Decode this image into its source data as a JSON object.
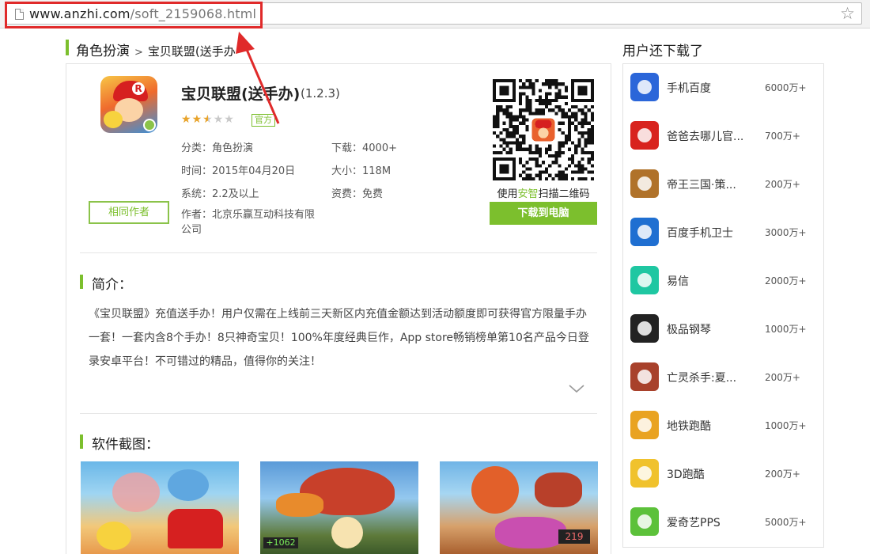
{
  "browser": {
    "url_domain": "www.anzhi.com",
    "url_path": "/soft_2159068.html"
  },
  "breadcrumb": {
    "category": "角色扮演",
    "separator": ">",
    "current": "宝贝联盟(送手办"
  },
  "app": {
    "title": "宝贝联盟(送手办)",
    "version": "(1.2.3)",
    "rating_text": "★★★★★",
    "rating_value": 2.5,
    "rating_max": 5,
    "official_badge": "官方",
    "category": "分类：角色扮演",
    "downloads": "下载：4000+",
    "date": "时间：2015年04月20日",
    "size": "大小：118M",
    "system": "系统：2.2及以上",
    "price": "资费：免费",
    "author": "作者：北京乐赢互动科技有限公司",
    "same_author_label": "相同作者"
  },
  "qr": {
    "caption_prefix": "使用",
    "caption_highlight": "安智",
    "caption_suffix": "扫描二维码",
    "download_label": "下载到电脑"
  },
  "intro": {
    "title": "简介：",
    "text": "《宝贝联盟》充值送手办！用户仅需在上线前三天新区内充值金额达到活动额度即可获得官方限量手办一套！一套内含8个手办！8只神奇宝贝！100%年度经典巨作，App store畅销榜单第10名产品今日登录安卓平台！不可错过的精品，值得你的关注！"
  },
  "screenshots": {
    "title": "软件截图："
  },
  "sidebar": {
    "title": "用户还下载了",
    "items": [
      {
        "name": "手机百度",
        "count": "6000万+",
        "icon": "baidu-icon",
        "color": "#2b66d9"
      },
      {
        "name": "爸爸去哪儿官...",
        "count": "700万+",
        "icon": "baba-icon",
        "color": "#d8231e"
      },
      {
        "name": "帝王三国·策...",
        "count": "200万+",
        "icon": "diwang-icon",
        "color": "#b0722a"
      },
      {
        "name": "百度手机卫士",
        "count": "3000万+",
        "icon": "shield-icon",
        "color": "#1f6fd1"
      },
      {
        "name": "易信",
        "count": "2000万+",
        "icon": "yixin-icon",
        "color": "#1fc7a2"
      },
      {
        "name": "极品钢琴",
        "count": "1000万+",
        "icon": "piano-icon",
        "color": "#222222"
      },
      {
        "name": "亡灵杀手:夏...",
        "count": "200万+",
        "icon": "undead-icon",
        "color": "#a8412b"
      },
      {
        "name": "地铁跑酷",
        "count": "1000万+",
        "icon": "subway-icon",
        "color": "#e9a322"
      },
      {
        "name": "3D跑酷",
        "count": "200万+",
        "icon": "run3d-icon",
        "color": "#f0c22d"
      },
      {
        "name": "爱奇艺PPS",
        "count": "5000万+",
        "icon": "pps-icon",
        "color": "#5cc13a"
      }
    ]
  },
  "colors": {
    "accent": "#7cbf2d",
    "annotation_red": "#e02a2a"
  }
}
